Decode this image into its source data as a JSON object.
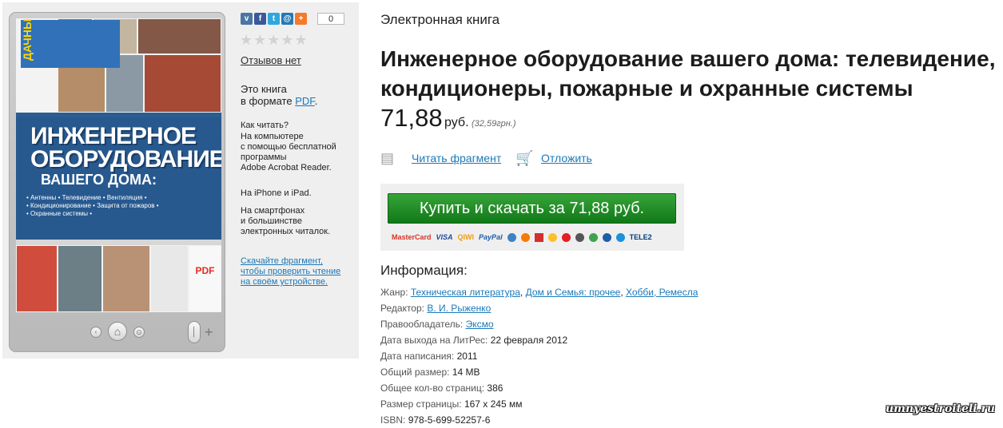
{
  "book": {
    "type_label": "Электронная книга",
    "title_line_1": "Инженерное оборудование вашего дома: телевидение,",
    "title_line_2": "кондиционеры, пожарные и охранные системы",
    "price": "71,88",
    "currency": "руб.",
    "alt_price": "(32,59грн.)",
    "read_fragment_label": "Читать фрагмент",
    "save_label": "Отложить",
    "buy_label": "Купить и скачать за 71,88 руб."
  },
  "sidebar": {
    "share_count": "0",
    "reviews": "Отзывов нет",
    "format_text_line_1": "Это книга",
    "format_text_line_2": "в формате",
    "format": "PDF",
    "format_suffix": ".",
    "how_to_read": "Как читать?",
    "desktop_line_1": "На компьютере",
    "desktop_line_2": "с помощью бесплатной",
    "desktop_line_3": "программы",
    "desktop_line_4": "Adobe Acrobat Reader.",
    "iphone": "На iPhone и iPad.",
    "smart_line_1": "На смартфонах",
    "smart_line_2": "и большинстве",
    "smart_line_3": "электронных читалок.",
    "download_line_1": "Скачайте фрагмент,",
    "download_line_2": "чтобы проверить чтение",
    "download_line_3": "на своём устройстве."
  },
  "cover": {
    "brand": "ДАЧНЫЙ ПОМОЩНИК",
    "title_1": "ИНЖЕНЕРНОЕ",
    "title_2": "ОБОРУДОВАНИЕ",
    "subtitle": "ВАШЕГО ДОМА:",
    "tags_line_1": "• Антенны • Телевидение • Вентиляция •",
    "tags_line_2": "• Кондиционирование • Защита от пожаров •",
    "tags_line_3": "• Охранные системы •",
    "pdf_label": "PDF"
  },
  "info": {
    "heading": "Информация:",
    "genre_label": "Жанр:",
    "genre_1": "Техническая литература",
    "genre_2": "Дом и Семья: прочее",
    "genre_3": "Хобби, Ремесла",
    "editor_label": "Редактор:",
    "editor": "В. И. Рыженко",
    "rights_label": "Правообладатель:",
    "rights": "Эксмо",
    "release_label": "Дата выхода на ЛитРес:",
    "release": "22 февраля 2012",
    "written_label": "Дата написания:",
    "written": "2011",
    "size_label": "Общий размер:",
    "size": "14 MB",
    "pages_label": "Общее кол-во страниц:",
    "pages": "386",
    "page_size_label": "Размер страницы:",
    "page_size": "167 x 245 мм",
    "isbn_label": "ISBN:",
    "isbn": "978-5-699-52257-6"
  },
  "payments": {
    "mastercard": "MasterCard",
    "visa": "VISA",
    "qiwi": "QIWI",
    "paypal": "PayPal",
    "tele2": "TELE2"
  },
  "watermark": "umnyestroiteli.ru",
  "colors": {
    "link": "#1b79b8",
    "buy_green": "#168a20"
  }
}
